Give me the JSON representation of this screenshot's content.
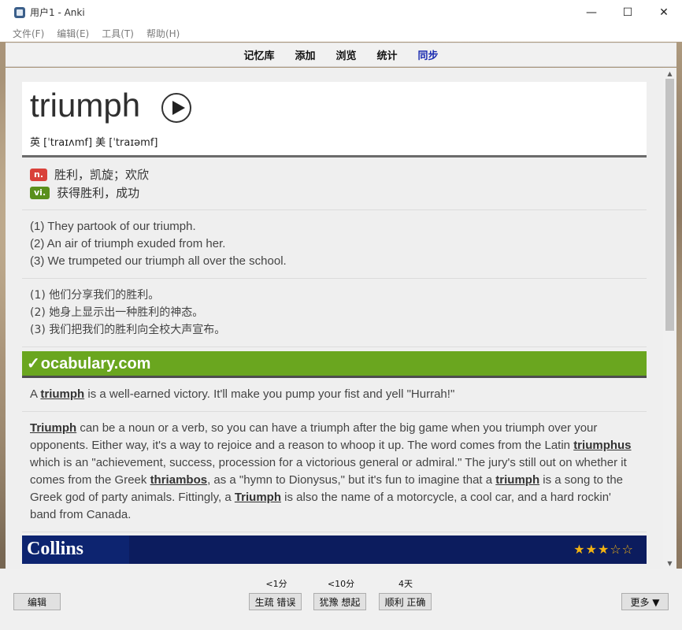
{
  "window": {
    "title": "用户1 - Anki",
    "controls": [
      "—",
      "☐",
      "✕"
    ]
  },
  "menu": [
    "文件(F)",
    "编辑(E)",
    "工具(T)",
    "帮助(H)"
  ],
  "toolbar": {
    "decks": "记忆库",
    "add": "添加",
    "browse": "浏览",
    "stats": "统计",
    "sync": "同步"
  },
  "card": {
    "word": "triumph",
    "phonetic": "英 [ˈtraɪʌmf] 美 [ˈtraɪəmf]",
    "definitions": [
      {
        "pos": "n.",
        "text": "胜利，凯旋；欢欣"
      },
      {
        "pos": "vi.",
        "text": "获得胜利，成功"
      }
    ],
    "examples_en": [
      "(1) They partook of our triumph.",
      "(2) An air of triumph exuded from her.",
      "(3) We trumpeted our triumph all over the school."
    ],
    "examples_cn": [
      "(1) 他们分享我们的胜利。",
      "(2) 她身上显示出一种胜利的神态。",
      "(3) 我们把我们的胜利向全校大声宣布。"
    ],
    "vocab_logo": "ocabulary.com",
    "vocab_short": {
      "pre": "A ",
      "word": "triumph",
      "post": " is a well-earned victory. It'll make you pump your fist and yell \"Hurrah!\""
    },
    "vocab_long": {
      "w1": "Triumph",
      "t1": " can be a noun or a verb, so you can have a triumph after the big game when you triumph over your opponents. Either way, it's a way to rejoice and a reason to whoop it up. The word comes from the Latin ",
      "w2": "triumphus",
      "t2": " which is an \"achievement, success, procession for a victorious general or admiral.\" The jury's still out on whether it comes from the Greek ",
      "w3": "thriambos",
      "t3": ", as a \"hymn to Dionysus,\" but it's fun to imagine that a ",
      "w4": "triumph",
      "t4": " is a song to the Greek god of party animals. Fittingly, a ",
      "w5": "Triumph",
      "t5": " is also the name of a motorcycle, a cool car, and a hard rockin' band from Canada."
    },
    "collins_logo": "Collins",
    "collins_stars": "★★★☆☆"
  },
  "bottom": {
    "edit": "编辑",
    "more": "更多 ▼",
    "answers": [
      {
        "interval": "<1分",
        "label": "生疏 错误"
      },
      {
        "interval": "<10分",
        "label": "犹豫 想起"
      },
      {
        "interval": "4天",
        "label": "顺利 正确"
      }
    ]
  },
  "scrollbar": {
    "up": "▲",
    "down": "▼"
  }
}
